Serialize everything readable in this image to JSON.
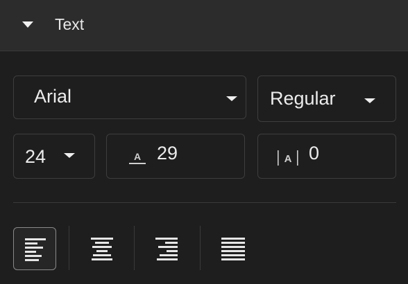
{
  "section": {
    "title": "Text",
    "collapse_icon": "caret-down-icon"
  },
  "font": {
    "family": "Arial",
    "style": "Regular",
    "size": "24",
    "line_height": "29",
    "letter_spacing": "0"
  },
  "line_height_icon_glyph": "A",
  "letter_spacing_icon_glyph": "A",
  "alignment": {
    "options": [
      "align-left",
      "align-center",
      "align-right",
      "align-justify"
    ],
    "selected": "align-left"
  },
  "colors": {
    "panel_bg": "#1e1e1e",
    "header_bg": "#2c2c2c",
    "border": "#3e3e3e",
    "text": "#ececec",
    "active_border": "#8a8a8a"
  }
}
